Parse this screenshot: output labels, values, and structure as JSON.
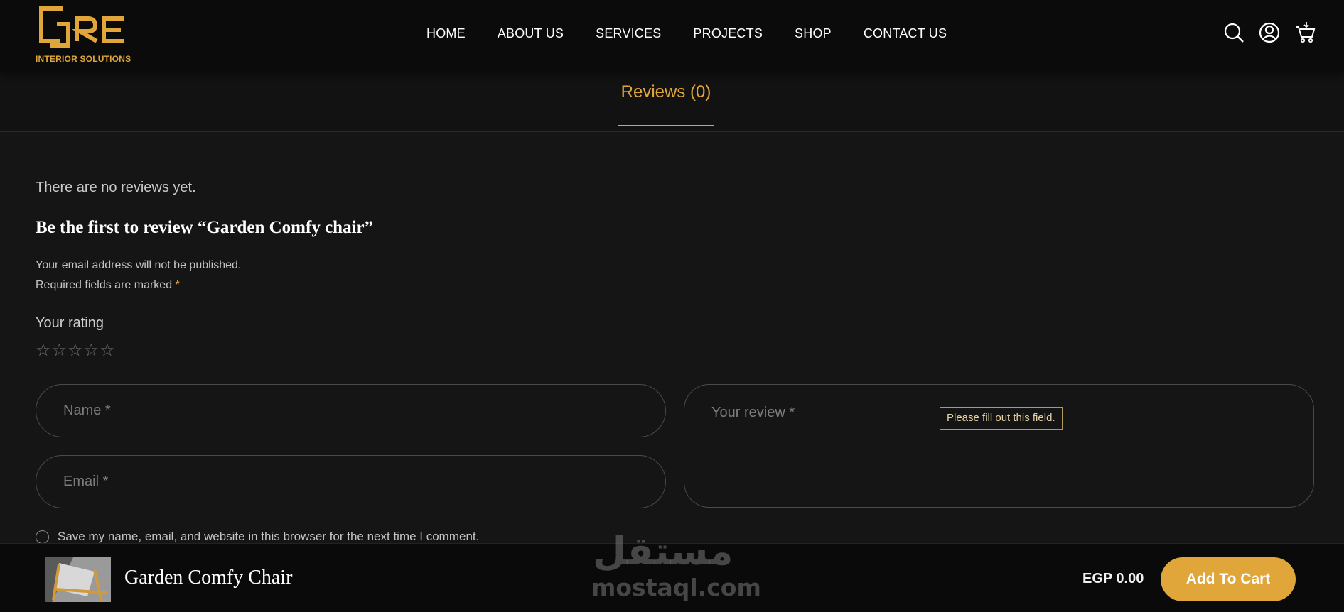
{
  "header": {
    "logo_sub": "INTERIOR SOLUTIONS",
    "nav": [
      "HOME",
      "ABOUT US",
      "SERVICES",
      "PROJECTS",
      "SHOP",
      "CONTACT US"
    ],
    "icons": [
      "search-icon",
      "user-icon",
      "cart-icon"
    ]
  },
  "tab": {
    "label": "Reviews (0)"
  },
  "reviews": {
    "empty_text": "There are no reviews yet.",
    "title": "Be the first to review “Garden Comfy chair”",
    "note1": "Your email address will not be published.",
    "note2_prefix": "Required fields are marked ",
    "required_star": "*",
    "rating_label": "Your rating",
    "rating": 0,
    "rating_max": 5,
    "name_placeholder": "Name *",
    "email_placeholder": "Email *",
    "review_placeholder": "Your review *",
    "tooltip": "Please fill out this field.",
    "save_text": "Save my name, email, and website in this browser for the next time I comment."
  },
  "sticky": {
    "product_name": "Garden Comfy Chair",
    "price": "EGP 0.00",
    "cart_label": "Add To Cart"
  },
  "watermark": {
    "arabic": "مستقل",
    "latin": "mostaql.com"
  },
  "colors": {
    "accent": "#e0a63a",
    "background": "#151515",
    "header": "#0b0b0b"
  }
}
